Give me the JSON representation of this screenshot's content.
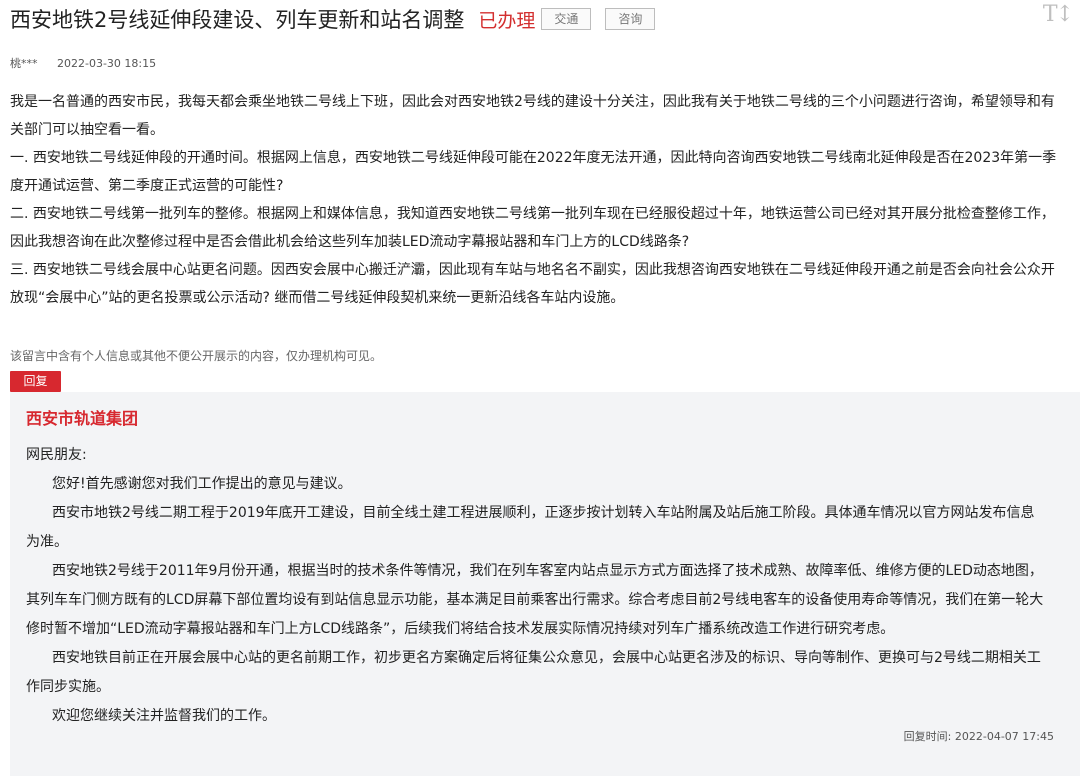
{
  "header": {
    "title": "西安地铁2号线延伸段建设、列车更新和站名调整",
    "status": "已办理",
    "tags": [
      "交通",
      "咨询"
    ],
    "font_toggle": "T↕"
  },
  "meta": {
    "author": "桃***",
    "time": "2022-03-30 18:15"
  },
  "question": {
    "lines": [
      "我是一名普通的西安市民，我每天都会乘坐地铁二号线上下班，因此会对西安地铁2号线的建设十分关注，因此我有关于地铁二号线的三个小问题进行咨询，希望领导和有",
      "关部门可以抽空看一看。",
      "一. 西安地铁二号线延伸段的开通时间。根据网上信息，西安地铁二号线延伸段可能在2022年度无法开通，因此特向咨询西安地铁二号线南北延伸段是否在2023年第一季",
      "度开通试运营、第二季度正式运营的可能性?",
      "二. 西安地铁二号线第一批列车的整修。根据网上和媒体信息，我知道西安地铁二号线第一批列车现在已经服役超过十年，地铁运营公司已经对其开展分批检查整修工作，",
      "因此我想咨询在此次整修过程中是否会借此机会给这些列车加装LED流动字幕报站器和车门上方的LCD线路条?",
      "三. 西安地铁二号线会展中心站更名问题。因西安会展中心搬迁浐灞，因此现有车站与地名名不副实，因此我想咨询西安地铁在二号线延伸段开通之前是否会向社会公众开",
      "放现“会展中心”站的更名投票或公示活动? 继而借二号线延伸段契机来统一更新沿线各车站内设施。"
    ]
  },
  "privacy_notice": "该留言中含有个人信息或其他不便公开展示的内容，仅办理机构可见。",
  "reply": {
    "tag": "回复",
    "org": "西安市轨道集团",
    "lines": [
      {
        "text": "网民朋友:",
        "indent": false
      },
      {
        "text": "您好!首先感谢您对我们工作提出的意见与建议。",
        "indent": true
      },
      {
        "text": "西安市地铁2号线二期工程于2019年底开工建设，目前全线土建工程进展顺利，正逐步按计划转入车站附属及站后施工阶段。具体通车情况以官方网站发布信息",
        "indent": true
      },
      {
        "text": "为准。",
        "indent": false
      },
      {
        "text": "西安地铁2号线于2011年9月份开通，根据当时的技术条件等情况，我们在列车客室内站点显示方式方面选择了技术成熟、故障率低、维修方便的LED动态地图，",
        "indent": true
      },
      {
        "text": "其列车车门侧方既有的LCD屏幕下部位置均设有到站信息显示功能，基本满足目前乘客出行需求。综合考虑目前2号线电客车的设备使用寿命等情况，我们在第一轮大",
        "indent": false
      },
      {
        "text": "修时暂不增加“LED流动字幕报站器和车门上方LCD线路条”，后续我们将结合技术发展实际情况持续对列车广播系统改造工作进行研究考虑。",
        "indent": false
      },
      {
        "text": "西安地铁目前正在开展会展中心站的更名前期工作，初步更名方案确定后将征集公众意见，会展中心站更名涉及的标识、导向等制作、更换可与2号线二期相关工",
        "indent": true
      },
      {
        "text": "作同步实施。",
        "indent": false
      },
      {
        "text": "欢迎您继续关注并监督我们的工作。",
        "indent": true
      }
    ],
    "time_label": "回复时间: 2022-04-07 17:45"
  }
}
